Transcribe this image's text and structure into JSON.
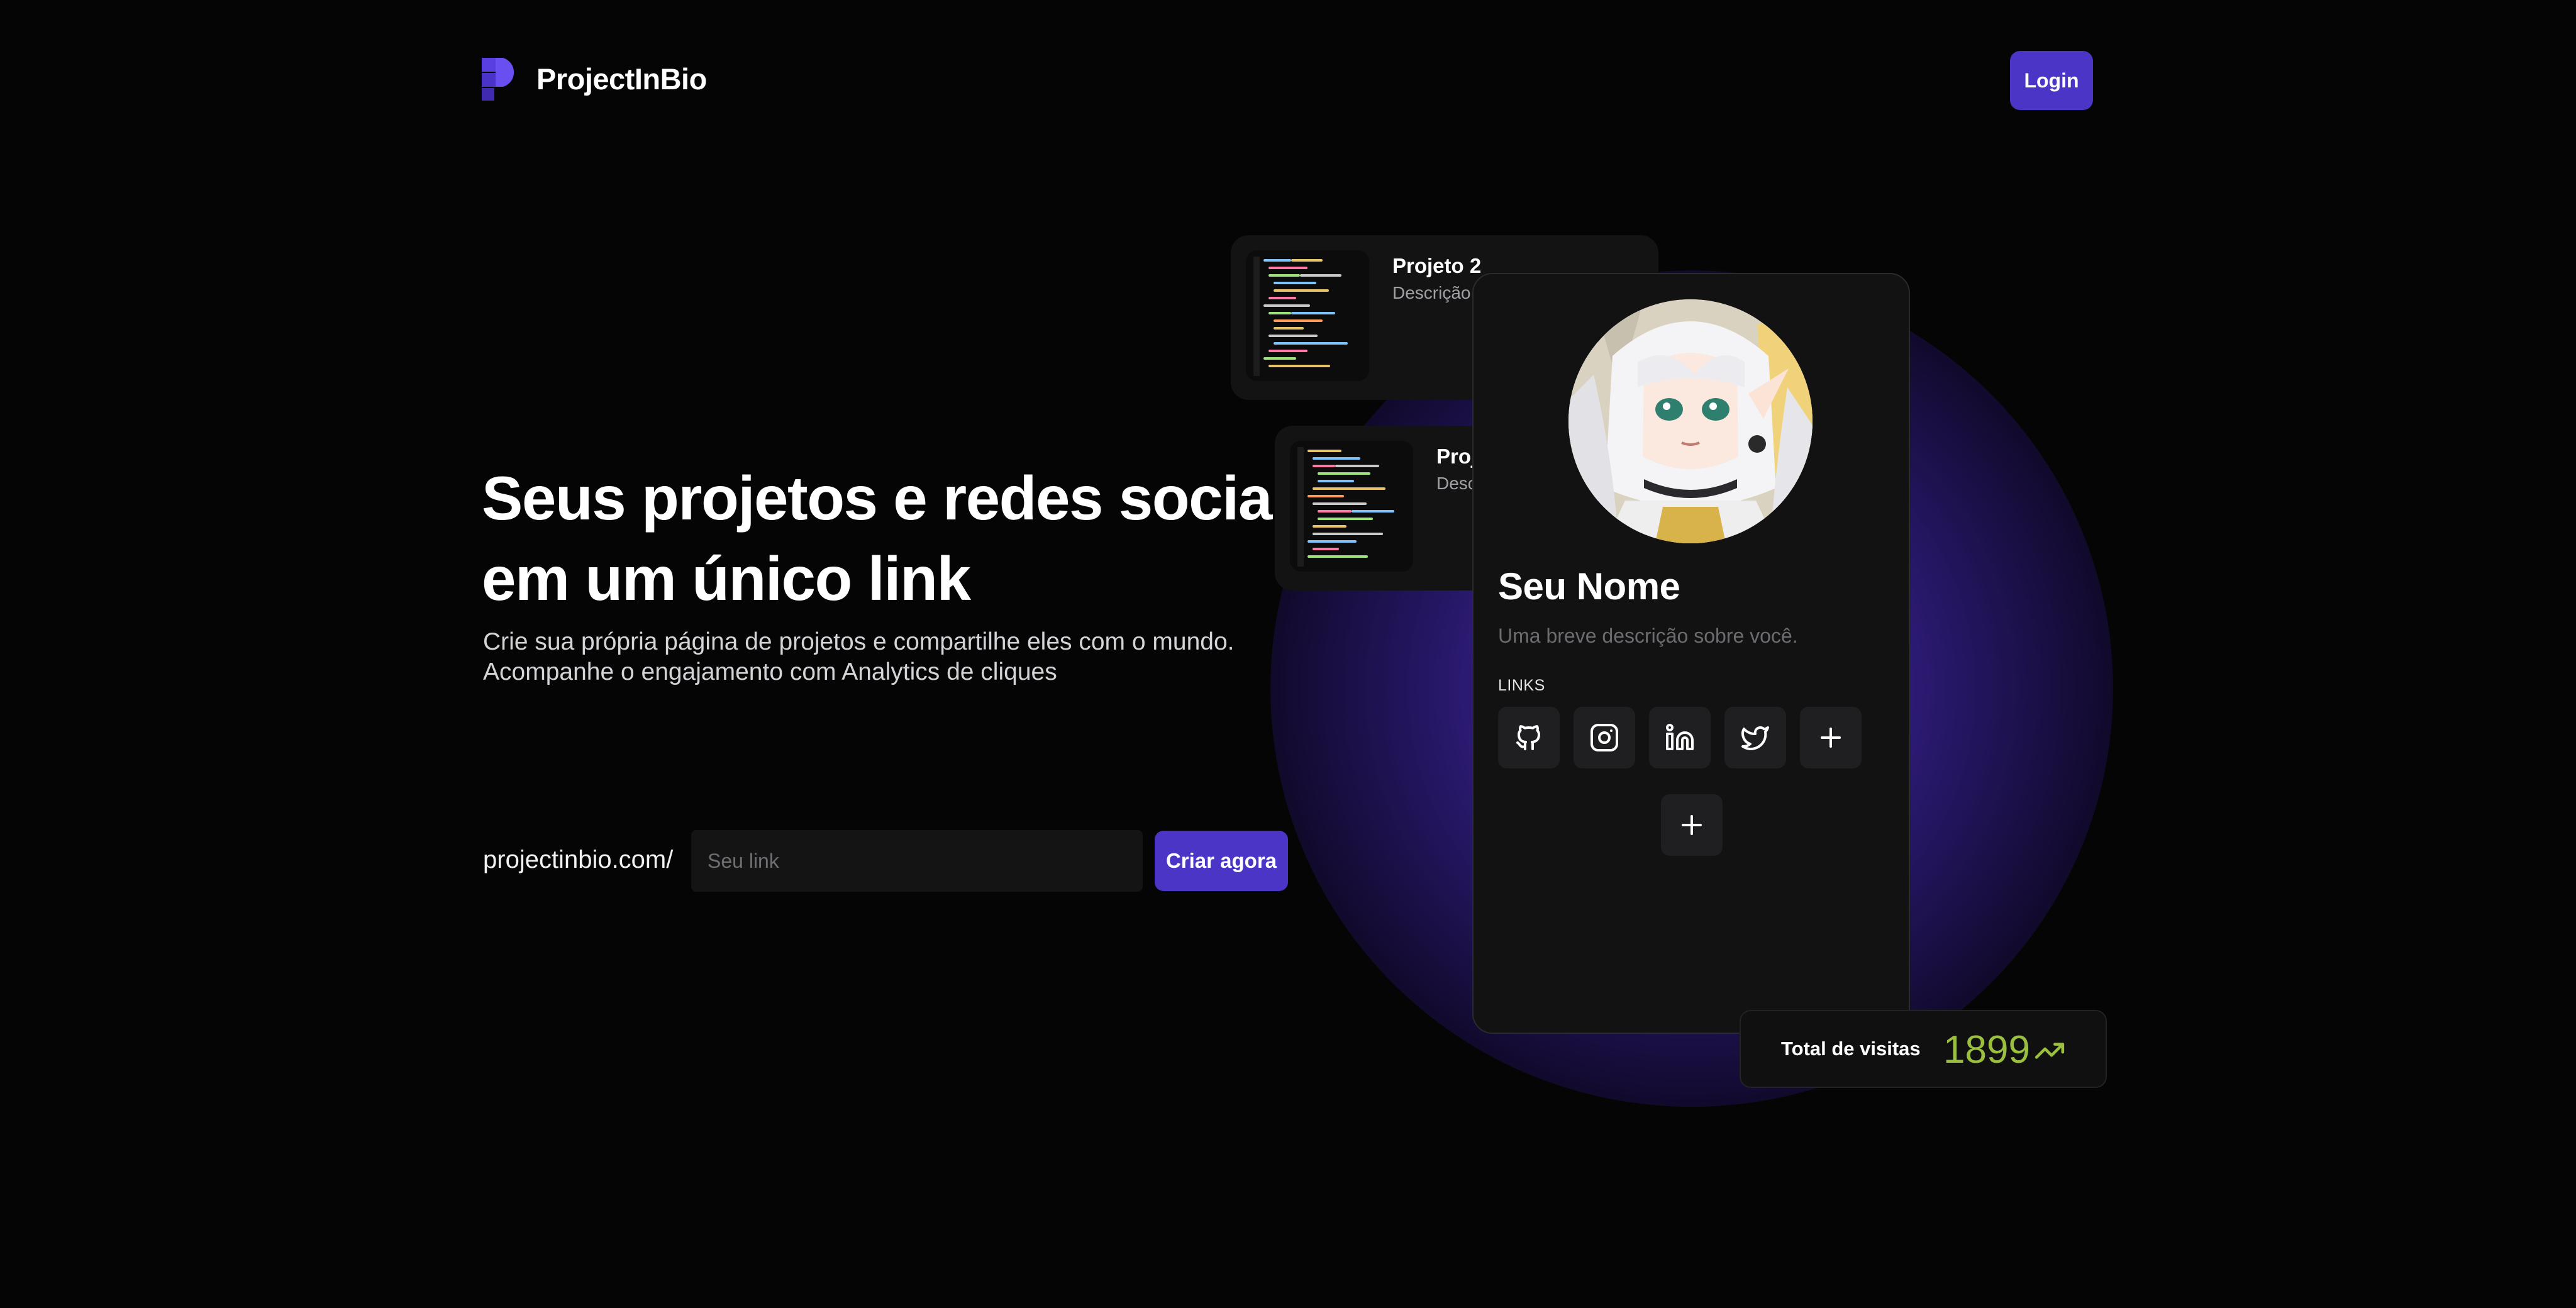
{
  "header": {
    "brand": "ProjectInBio",
    "login_label": "Login",
    "logo_icon": "projectinbio-logo-icon"
  },
  "hero": {
    "title_line1": "Seus projetos e redes sociais",
    "title_line2": "em um único link",
    "subtitle_line1": "Crie sua própria página de projetos e compartilhe eles com o mundo.",
    "subtitle_line2": "Acompanhe o engajamento com Analytics de cliques"
  },
  "create_link": {
    "prefix": "projectinbio.com/",
    "input_value": "",
    "input_placeholder": "Seu link",
    "button_label": "Criar agora"
  },
  "projects": [
    {
      "title": "Projeto 2",
      "description": "Descrição"
    },
    {
      "title": "Proj",
      "description": "Desc"
    }
  ],
  "profile": {
    "name": "Seu Nome",
    "description": "Uma breve descrição sobre você.",
    "links_label": "LINKS",
    "social_icons": [
      "github-icon",
      "instagram-icon",
      "linkedin-icon",
      "twitter-icon",
      "plus-icon"
    ],
    "add_project_icon": "plus-icon"
  },
  "visits": {
    "label": "Total de visitas",
    "value": "1899",
    "trend_icon": "trending-up-icon"
  },
  "colors": {
    "accent": "#4a35c6",
    "background": "#050505",
    "card": "#121212",
    "visits_green": "#9bbf3e"
  }
}
